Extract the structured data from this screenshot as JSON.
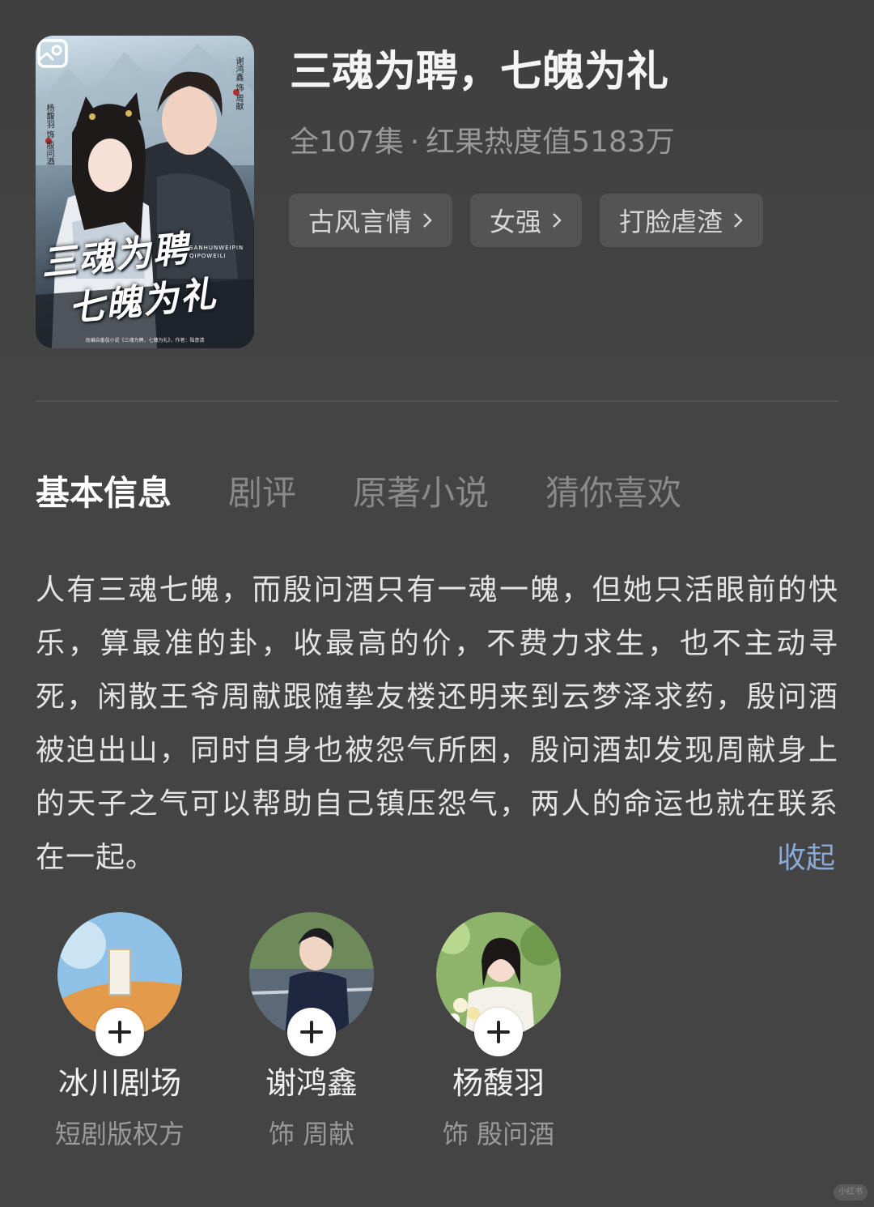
{
  "drama": {
    "title": "三魂为聘，七魄为礼",
    "episodes": "全107集",
    "separator": "·",
    "popularity": "红果热度值5183万",
    "tags": [
      {
        "label": "古风言情"
      },
      {
        "label": "女强"
      },
      {
        "label": "打脸虐渣"
      }
    ]
  },
  "poster": {
    "title_line1": "三魂为聘",
    "title_line2": "七魄为礼",
    "pinyin_line1": "SANHUNWEIPIN",
    "pinyin_line2": "QIPOWEILI",
    "credit_left": "杨馥羽 饰 殷问酒",
    "credit_right": "谢鸿鑫 饰 周献",
    "footnote": "改编自番茄小说《三魂为聘，七魄为礼》，作者：陆意清"
  },
  "tabs": [
    {
      "label": "基本信息",
      "active": true
    },
    {
      "label": "剧评",
      "active": false
    },
    {
      "label": "原著小说",
      "active": false
    },
    {
      "label": "猜你喜欢",
      "active": false
    }
  ],
  "synopsis": {
    "text": "人有三魂七魄，而殷问酒只有一魂一魄，但她只活眼前的快乐，算最准的卦，收最高的价，不费力求生，也不主动寻死，闲散王爷周献跟随挚友楼还明来到云梦泽求药，殷问酒被迫出山，同时自身也被怨气所困，殷问酒却发现周献身上的天子之气可以帮助自己镇压怨气，两人的命运也就在联系在一起。",
    "collapse_label": "收起"
  },
  "cast": [
    {
      "name": "冰川剧场",
      "role": "短剧版权方"
    },
    {
      "name": "谢鸿鑫",
      "role": "饰  周献"
    },
    {
      "name": "杨馥羽",
      "role": "饰  殷问酒"
    }
  ],
  "watermark": "小红书",
  "colors": {
    "background": "#444444",
    "link": "#8aa9d6",
    "tag_bg": "#545454"
  }
}
